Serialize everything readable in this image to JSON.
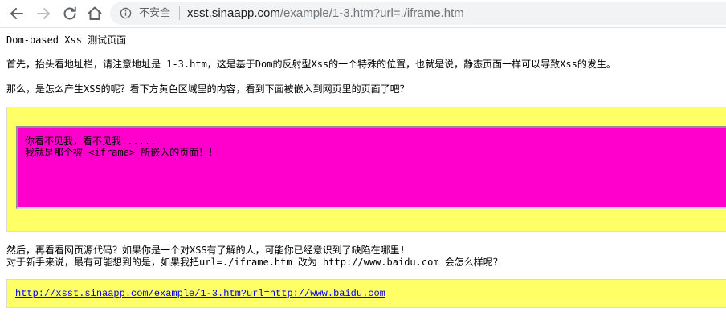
{
  "browser": {
    "back_icon": "arrow-left-icon",
    "forward_icon": "arrow-right-icon",
    "reload_icon": "reload-icon",
    "home_icon": "home-icon",
    "info_icon": "info-circle-icon",
    "security_label": "不安全",
    "url_host": "xsst.sinaapp.com",
    "url_path": "/example/1-3.htm?url=./iframe.htm"
  },
  "page": {
    "title_line": "Dom-based Xss 测试页面",
    "para1": "首先，抬头看地址栏，请注意地址是 1-3.htm，这是基于Dom的反射型Xss的一个特殊的位置，也就是说，静态页面一样可以导致Xss的发生。",
    "para2": "那么，是怎么产生XSS的呢？看下方黄色区域里的内容，看到下面被嵌入到网页里的页面了吧？",
    "iframe_line1": "你看不见我，看不见我......",
    "iframe_line2": "我就是那个被 <iframe> 所嵌入的页面！！",
    "para3_line1": "然后，再看看网页源代码？如果你是一个对XSS有了解的人，可能你已经意识到了缺陷在哪里!",
    "para3_line2": "对于新手来说，最有可能想到的是，如果我把url=./iframe.htm 改为 http://www.baidu.com 会怎么样呢？",
    "link_text": "http://xsst.sinaapp.com/example/1-3.htm?url=http://www.baidu.com"
  },
  "colors": {
    "yellow_area": "#ffff66",
    "iframe_bg": "#ff00cc",
    "link": "#0000ee"
  }
}
